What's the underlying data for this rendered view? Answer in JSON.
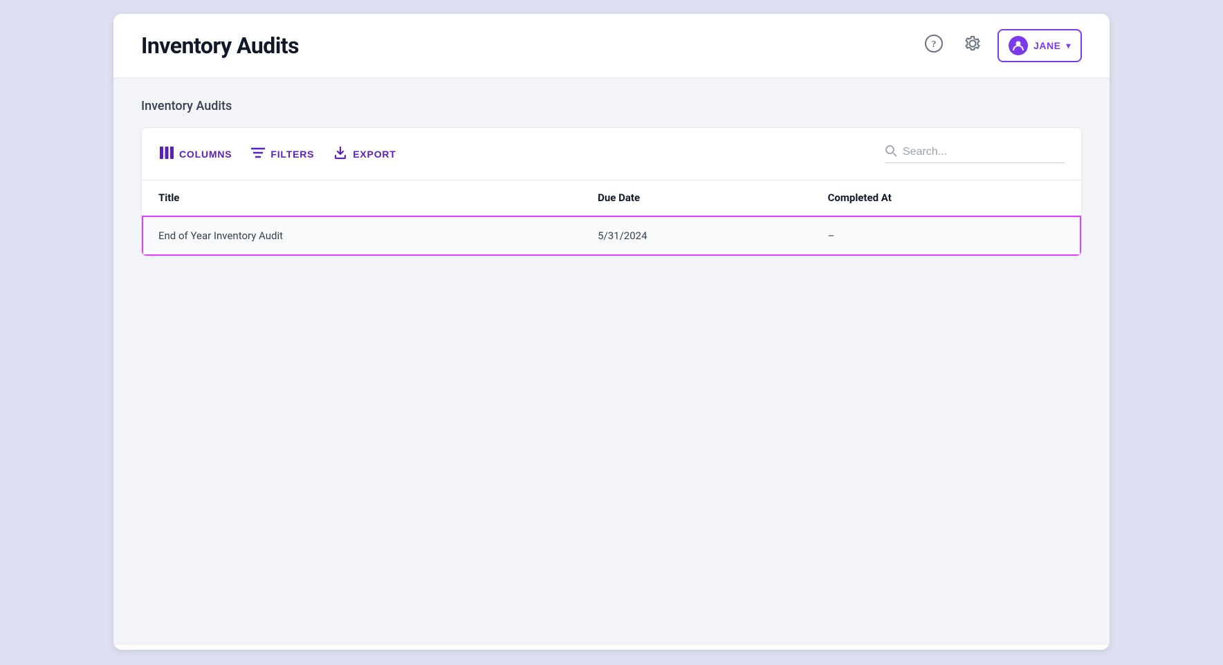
{
  "header": {
    "title": "Inventory Audits",
    "help_icon": "?",
    "settings_icon": "⚙",
    "user": {
      "name": "JANE",
      "chevron": "▾"
    }
  },
  "main": {
    "subtitle": "Inventory Audits",
    "toolbar": {
      "columns_label": "COLUMNS",
      "filters_label": "FILTERS",
      "export_label": "EXPORT",
      "search_placeholder": "Search..."
    },
    "table": {
      "columns": [
        {
          "key": "title",
          "label": "Title"
        },
        {
          "key": "due_date",
          "label": "Due Date"
        },
        {
          "key": "completed_at",
          "label": "Completed At"
        }
      ],
      "rows": [
        {
          "title": "End of Year Inventory Audit",
          "due_date": "5/31/2024",
          "completed_at": "–",
          "highlighted": true
        }
      ]
    }
  },
  "colors": {
    "accent": "#7c3aed",
    "highlight_border": "#e040fb"
  }
}
